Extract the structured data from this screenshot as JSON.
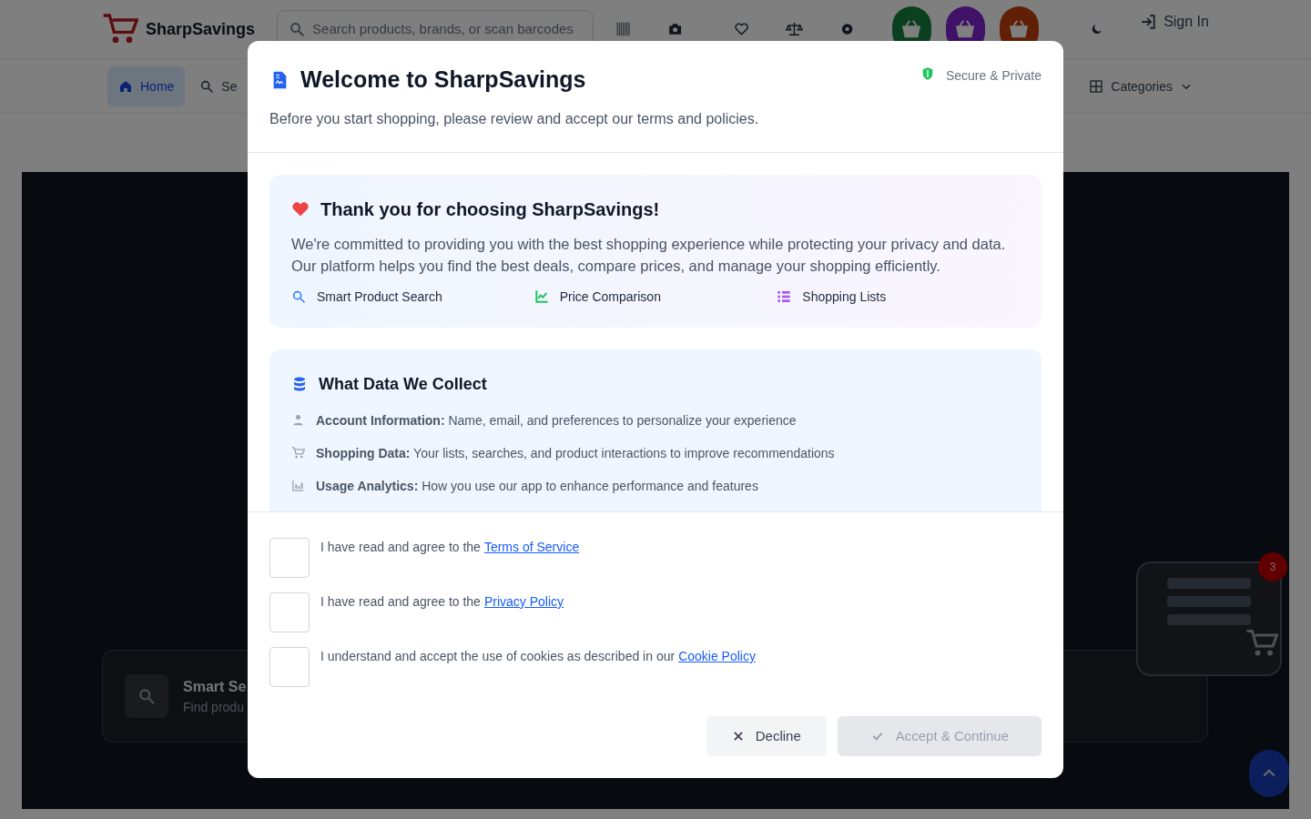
{
  "header": {
    "logo": "SharpSavings",
    "search_placeholder": "Search products, brands, or scan barcodes",
    "sign_in": "Sign In"
  },
  "nav": {
    "items": [
      {
        "label": "Home",
        "selected": true
      },
      {
        "label": "Se",
        "selected": false
      }
    ],
    "categories": "Categories"
  },
  "hero": {
    "card_title": "Smart Se",
    "card_subtitle": "Find produ",
    "badge": "3"
  },
  "modal": {
    "title": "Welcome to SharpSavings",
    "subtitle": "Before you start shopping, please review and accept our terms and policies.",
    "secure_label": "Secure & Private",
    "thanks": {
      "title": "Thank you for choosing SharpSavings!",
      "body": "We're committed to providing you with the best shopping experience while protecting your privacy and data. Our platform helps you find the best deals, compare prices, and manage your shopping efficiently.",
      "features": [
        {
          "kind": "search",
          "label": "Smart Product Search",
          "color": "#3b82f6"
        },
        {
          "kind": "chart",
          "label": "Price Comparison",
          "color": "#22c55e"
        },
        {
          "kind": "list",
          "label": "Shopping Lists",
          "color": "#a855f7"
        }
      ]
    },
    "data_section": {
      "title": "What Data We Collect",
      "items": [
        {
          "kind": "account",
          "label": "Account Information:",
          "text": "Name, email, and preferences to personalize your experience"
        },
        {
          "kind": "cart",
          "label": "Shopping Data:",
          "text": "Your lists, searches, and product interactions to improve recommendations"
        },
        {
          "kind": "analytics",
          "label": "Usage Analytics:",
          "text": "How you use our app to enhance performance and features"
        }
      ]
    },
    "agreements": [
      {
        "text": "I have read and agree to the",
        "link": "Terms of Service",
        "checked": false
      },
      {
        "text": "I have read and agree to the",
        "link": "Privacy Policy",
        "checked": false
      },
      {
        "text": "I understand and accept the use of cookies as described in our",
        "link": "Cookie Policy",
        "checked": false
      }
    ],
    "decline": "Decline",
    "accept": {
      "label": "Accept & Continue",
      "disabled": true
    }
  }
}
